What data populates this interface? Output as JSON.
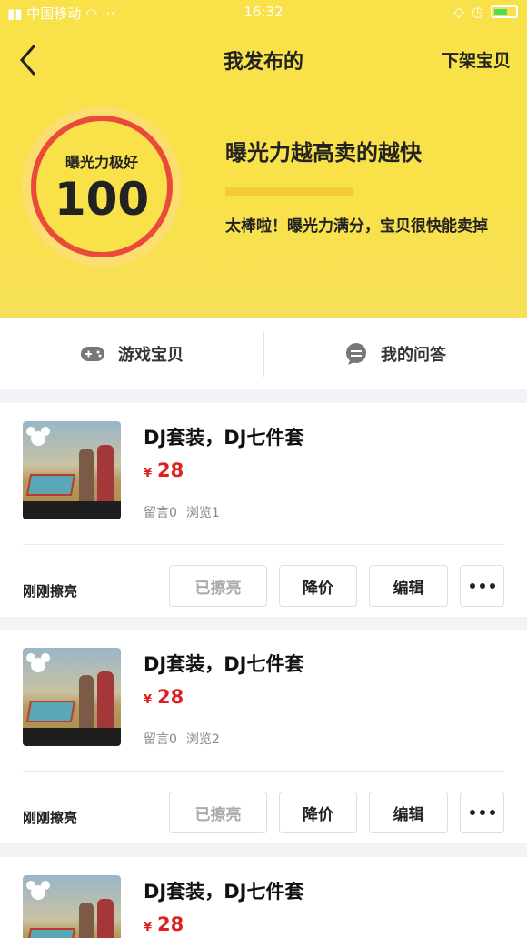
{
  "status_bar": {
    "carrier": "中国移动",
    "time": "16:32"
  },
  "nav": {
    "title": "我发布的",
    "right_action": "下架宝贝"
  },
  "exposure": {
    "label": "曝光力极好",
    "score": "100",
    "headline": "曝光力越高卖的越快",
    "description": "太棒啦！曝光力满分，宝贝很快能卖掉"
  },
  "tabs": [
    {
      "label": "游戏宝贝",
      "icon": "gamepad-icon"
    },
    {
      "label": "我的问答",
      "icon": "chat-bubble-icon"
    }
  ],
  "items": [
    {
      "title": "DJ套装，DJ七件套",
      "currency": "¥",
      "price": "28",
      "comments": "留言0",
      "views": "浏览1",
      "status": "刚刚擦亮",
      "actions": {
        "refreshed": "已擦亮",
        "reduce": "降价",
        "edit": "编辑"
      }
    },
    {
      "title": "DJ套装，DJ七件套",
      "currency": "¥",
      "price": "28",
      "comments": "留言0",
      "views": "浏览2",
      "status": "刚刚擦亮",
      "actions": {
        "refreshed": "已擦亮",
        "reduce": "降价",
        "edit": "编辑"
      }
    },
    {
      "title": "DJ套装，DJ七件套",
      "currency": "¥",
      "price": "28"
    }
  ],
  "colors": {
    "brand_yellow": "#f9e14a",
    "ring_red": "#e94a3a",
    "price_red": "#e02020"
  }
}
